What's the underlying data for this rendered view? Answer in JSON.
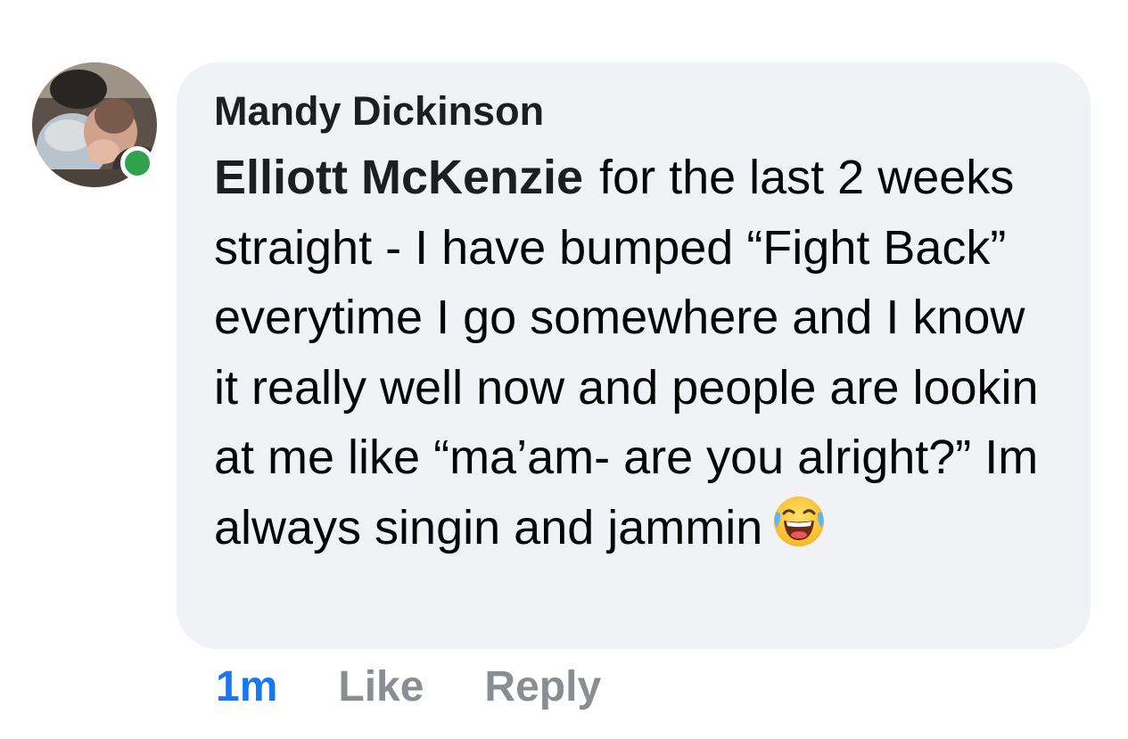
{
  "comment": {
    "author": "Mandy Dickinson",
    "mention": "Elliott McKenzie",
    "text": "for the last 2 weeks straight - I have bumped “Fight Back” everytime I go somewhere and I know it really well now and people are lookin at me like “ma’am- are you alright?” Im always singin and jammin",
    "emoji": "laughing-crying-emoji",
    "timestamp": "1m",
    "online": true
  },
  "actions": {
    "like_label": "Like",
    "reply_label": "Reply"
  },
  "colors": {
    "bubble": "#f0f2f5",
    "online_dot": "#31a24c",
    "timestamp": "#1877f2",
    "action": "#8a8d91"
  }
}
